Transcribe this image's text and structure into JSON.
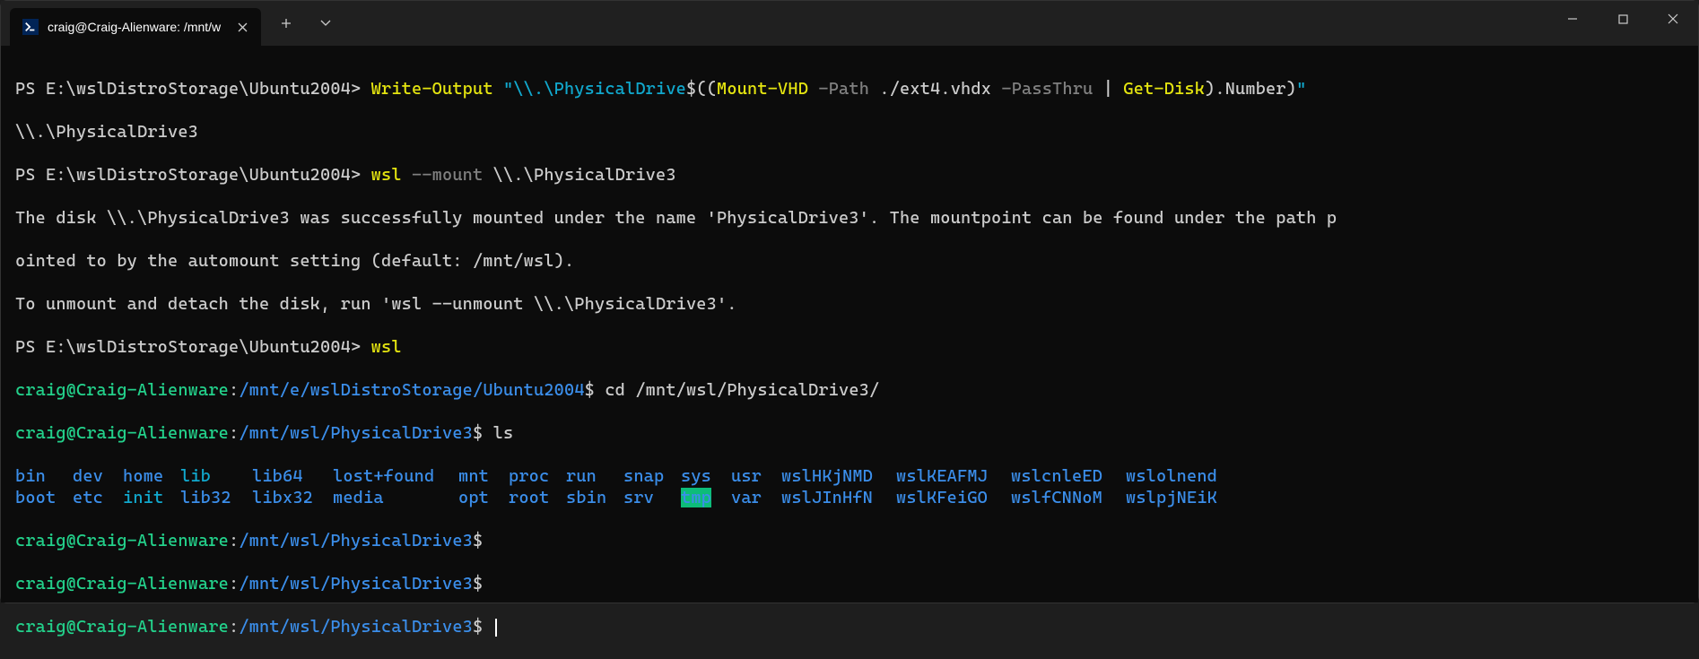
{
  "tab": {
    "title": "craig@Craig-Alienware: /mnt/w"
  },
  "ps_prompt": "PS E:\\wslDistroStorage\\Ubuntu2004>",
  "cmd1": {
    "writeOutput": "Write-Output",
    "str1": "\"\\\\.\\PhysicalDrive",
    "dollar": "$(",
    "paren": "(",
    "mountvhd": "Mount-VHD",
    "pathflag": " -Path",
    "pathval": " ./ext4.vhdx",
    "passthru": " -PassThru",
    "pipe": " |",
    "getdisk": " Get-Disk",
    "close": ")",
    "dot": ".",
    "number": "Number",
    "close2": ")",
    "str2": "\""
  },
  "out1": "\\\\.\\PhysicalDrive3",
  "cmd2": {
    "wsl": "wsl",
    "mount": " --mount",
    "arg": " \\\\.\\PhysicalDrive3"
  },
  "out2a": "The disk \\\\.\\PhysicalDrive3 was successfully mounted under the name 'PhysicalDrive3'. The mountpoint can be found under the path p",
  "out2b": "ointed to by the automount setting (default: /mnt/wsl).",
  "out2c": "To unmount and detach the disk, run 'wsl --unmount \\\\.\\PhysicalDrive3'.",
  "cmd3": "wsl",
  "bash": {
    "userhost": "craig@Craig-Alienware",
    "colon": ":",
    "path1": "/mnt/e/wslDistroStorage/Ubuntu2004",
    "path2": "/mnt/wsl/PhysicalDrive3",
    "dollar": "$"
  },
  "bashcmd1": " cd /mnt/wsl/PhysicalDrive3/",
  "bashcmd2": " ls",
  "ls": {
    "row1": [
      "bin",
      "dev",
      "home",
      "lib",
      "lib64",
      "lost+found",
      "mnt",
      "proc",
      "run",
      "snap",
      "sys",
      "usr",
      "wslHKjNMD",
      "wslKEAFMJ",
      "wslcnleED",
      "wslolnend"
    ],
    "row2": [
      "boot",
      "etc",
      "init",
      "lib32",
      "libx32",
      "media",
      "opt",
      "root",
      "sbin",
      "srv",
      "tmp",
      "var",
      "wslJInHfN",
      "wslKFeiGO",
      "wslfCNNoM",
      "wslpjNEiK"
    ]
  }
}
